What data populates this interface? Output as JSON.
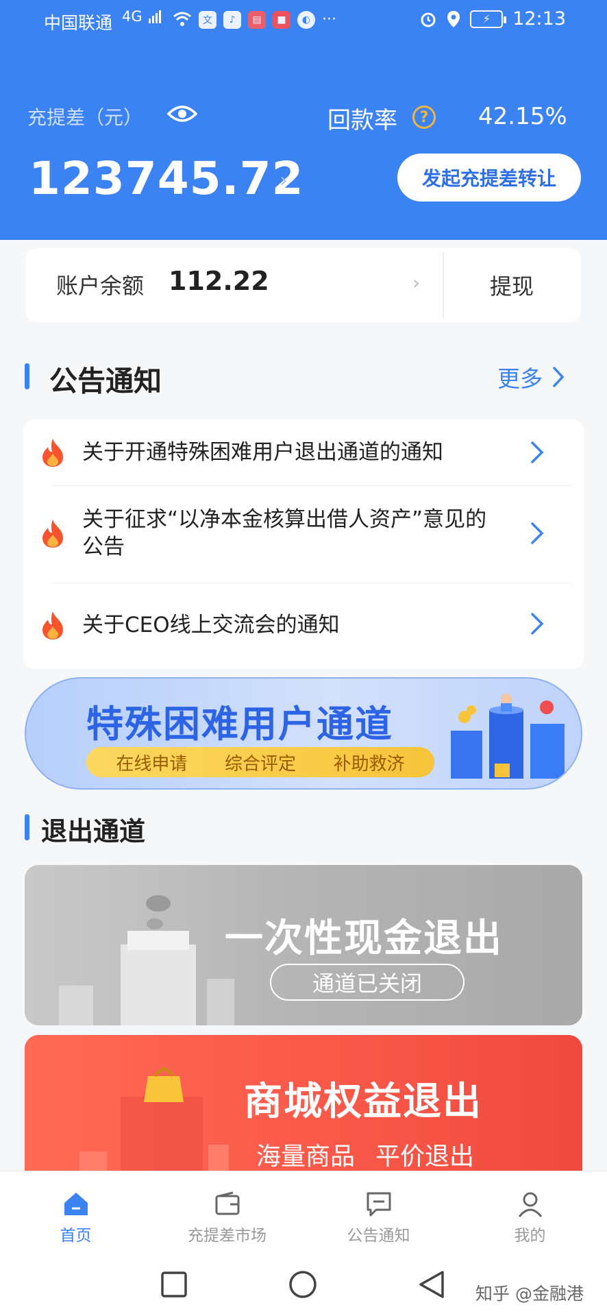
{
  "status_bar": {
    "carrier": "中国联通",
    "network": "4G",
    "time": "12:13"
  },
  "header": {
    "chongti_label": "充提差（元）",
    "huikuan_label": "回款率",
    "huikuan_rate": "42.15%",
    "chongti_amount": "123745.72",
    "transfer_button": "发起充提差转让"
  },
  "account": {
    "label": "账户余额",
    "amount": "112.22",
    "withdraw": "提现"
  },
  "notices": {
    "title": "公告通知",
    "more": "更多",
    "items": [
      {
        "text": "关于开通特殊困难用户退出通道的通知"
      },
      {
        "text": "关于征求“以净本金核算出借人资产”意见的公告"
      },
      {
        "text": "关于CEO线上交流会的通知"
      }
    ]
  },
  "banner": {
    "title": "特殊困难用户通道",
    "tags": [
      "在线申请",
      "综合评定",
      "补助救济"
    ]
  },
  "exit": {
    "title": "退出通道",
    "cash": {
      "title": "一次性现金退出",
      "status": "通道已关闭"
    },
    "mall": {
      "title": "商城权益退出",
      "sub1": "海量商品",
      "sub2": "平价退出"
    }
  },
  "tabs": [
    {
      "label": "首页",
      "icon": "home-icon",
      "active": true
    },
    {
      "label": "充提差市场",
      "icon": "wallet-icon",
      "active": false
    },
    {
      "label": "公告通知",
      "icon": "message-icon",
      "active": false
    },
    {
      "label": "我的",
      "icon": "user-icon",
      "active": false
    }
  ],
  "watermark": "知乎 @金融港",
  "colors": {
    "primary": "#3b82f2",
    "accent_gold": "#f0b63c",
    "exit_red": "#fb5a4a",
    "exit_gray": "#b4b4b4"
  }
}
